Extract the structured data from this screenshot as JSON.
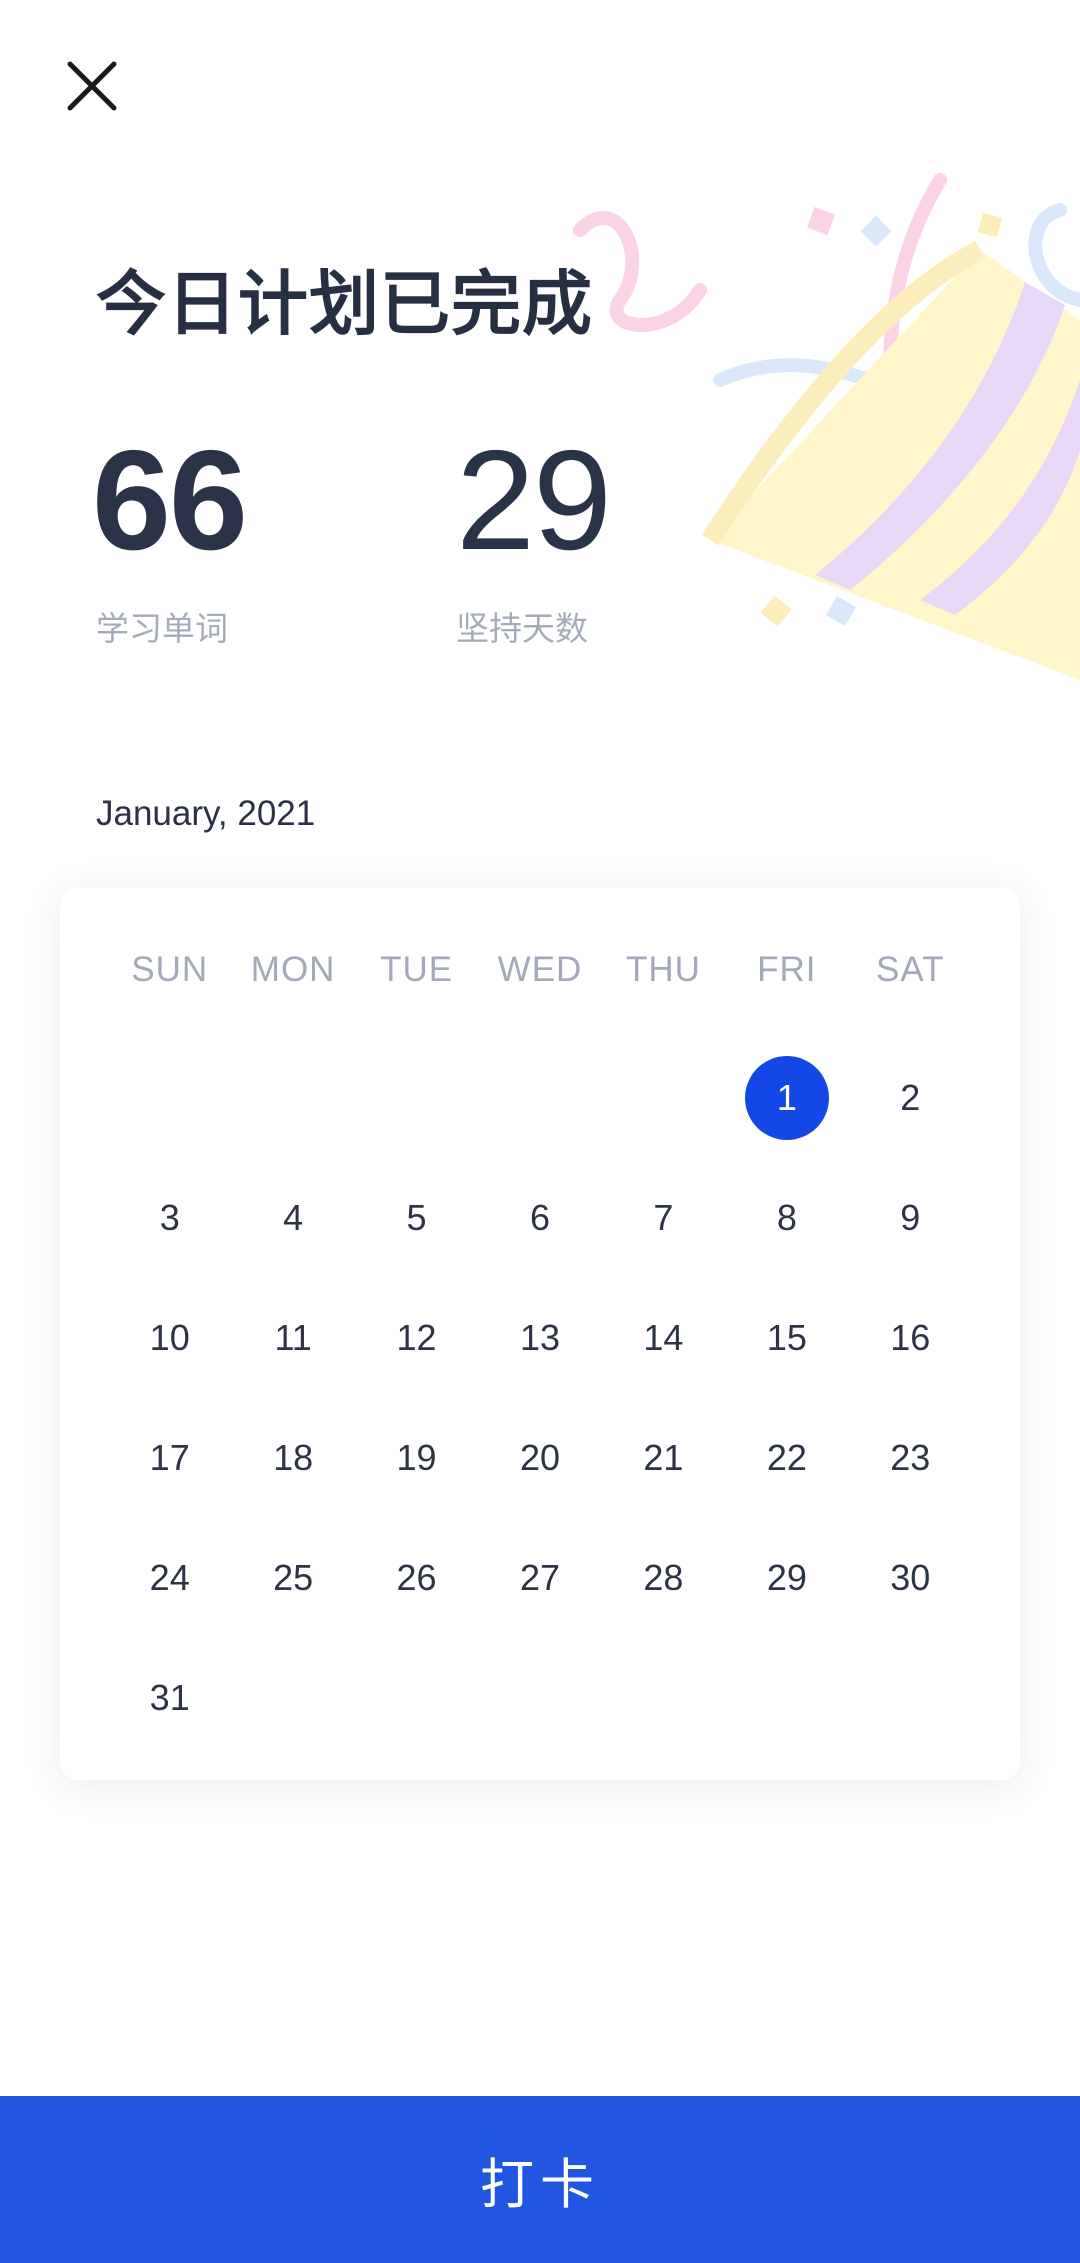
{
  "header": {
    "close_icon": "close-icon",
    "title": "今日计划已完成",
    "decoration_icon": "party-popper-icon"
  },
  "stats": [
    {
      "value": "66",
      "label": "学习单词"
    },
    {
      "value": "29",
      "label": "坚持天数"
    }
  ],
  "calendar": {
    "month_title": "January, 2021",
    "weekdays": [
      "SUN",
      "MON",
      "TUE",
      "WED",
      "THU",
      "FRI",
      "SAT"
    ],
    "leading_empty_days": 5,
    "days": [
      "1",
      "2",
      "3",
      "4",
      "5",
      "6",
      "7",
      "8",
      "9",
      "10",
      "11",
      "12",
      "13",
      "14",
      "15",
      "16",
      "17",
      "18",
      "19",
      "20",
      "21",
      "22",
      "23",
      "24",
      "25",
      "26",
      "27",
      "28",
      "29",
      "30",
      "31"
    ],
    "selected_day": "1"
  },
  "footer": {
    "checkin_label": "打卡"
  },
  "colors": {
    "accent": "#1448e6",
    "button": "#2156e0",
    "text_primary": "#2b3247",
    "text_secondary": "#a4abb9"
  }
}
